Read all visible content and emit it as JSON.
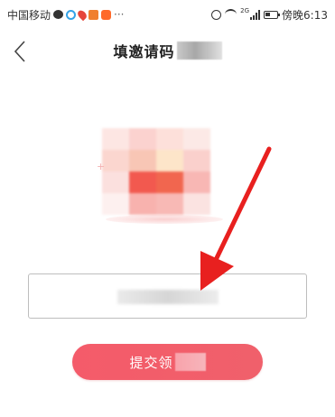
{
  "status_bar": {
    "carrier": "中国移动",
    "network_type": "2G",
    "time": "傍晚6:13",
    "more_symbol": "···",
    "left_icons": [
      "chat-bubble-icon",
      "qq-icon",
      "map-pin-icon",
      "app-p-icon",
      "app-d-icon"
    ],
    "right_icons": [
      "alarm-icon",
      "wifi-icon",
      "signal-icon",
      "battery-icon"
    ]
  },
  "header": {
    "back_symbol": "<",
    "title": "填邀请码"
  },
  "illustration": {
    "icon": "gift-illustration",
    "sparkle": "+",
    "colors": [
      "#fde6e3",
      "#fbd2cf",
      "#fde0da",
      "#fce9e6",
      "#fbd6cf",
      "#f8c6b5",
      "#fde5c9",
      "#fad0cc",
      "#fbe0de",
      "#f2594f",
      "#f1664f",
      "#f8b7b4",
      "#fdf0ef",
      "#f8b2ae",
      "#f8b9b5",
      "#fbe3e1"
    ]
  },
  "invite_input": {
    "value": "",
    "placeholder": ""
  },
  "submit": {
    "label": "提交领"
  },
  "colors": {
    "accent": "#f45b6a",
    "arrow": "#e8201f"
  }
}
